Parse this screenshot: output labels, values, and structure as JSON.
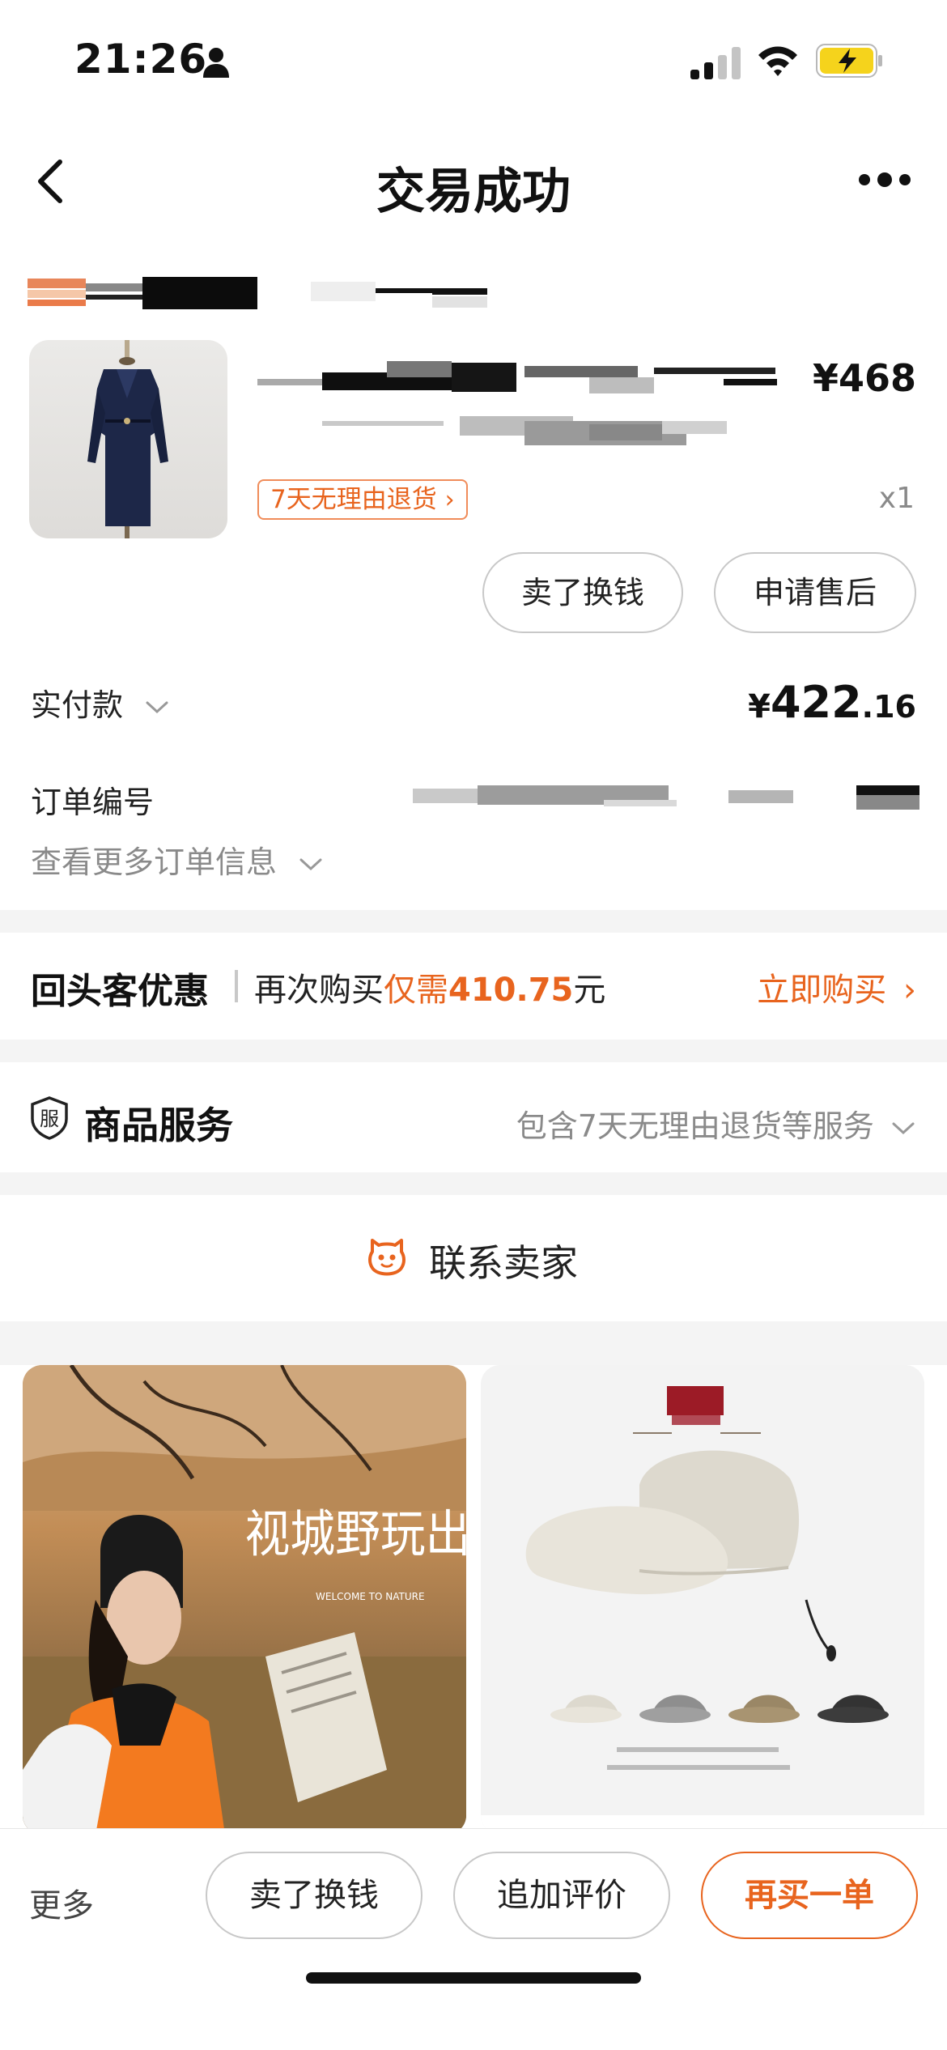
{
  "status": {
    "time": "21:26"
  },
  "nav": {
    "title": "交易成功"
  },
  "product": {
    "price": "¥468",
    "quantity": "x1",
    "return_tag": "7天无理由退货",
    "actions": [
      "卖了换钱",
      "申请售后"
    ]
  },
  "payment": {
    "paid_label": "实付款",
    "paid_symbol": "¥",
    "paid_integer": "422",
    "paid_decimal": ".16",
    "order_number_label": "订单编号",
    "more_info": "查看更多订单信息"
  },
  "returning_customer": {
    "title": "回头客优惠",
    "text_prefix": "再次购买",
    "text_need": "仅需",
    "text_amount": "410.75",
    "text_suffix": "元",
    "buy_label": "立即购买"
  },
  "service": {
    "icon_char": "服",
    "title": "商品服务",
    "description": "包含7天无理由退货等服务"
  },
  "contact": {
    "label": "联系卖家"
  },
  "recommendations": {
    "left_overlay": "视城野玩出色",
    "left_overlay_small": "WELCOME TO NATURE"
  },
  "bottom_bar": {
    "more": "更多",
    "sell": "卖了换钱",
    "review": "追加评价",
    "rebuy": "再买一单"
  },
  "colors": {
    "accent": "#e8641e",
    "muted": "#8a8a8a",
    "separator": "#f4f4f4"
  }
}
